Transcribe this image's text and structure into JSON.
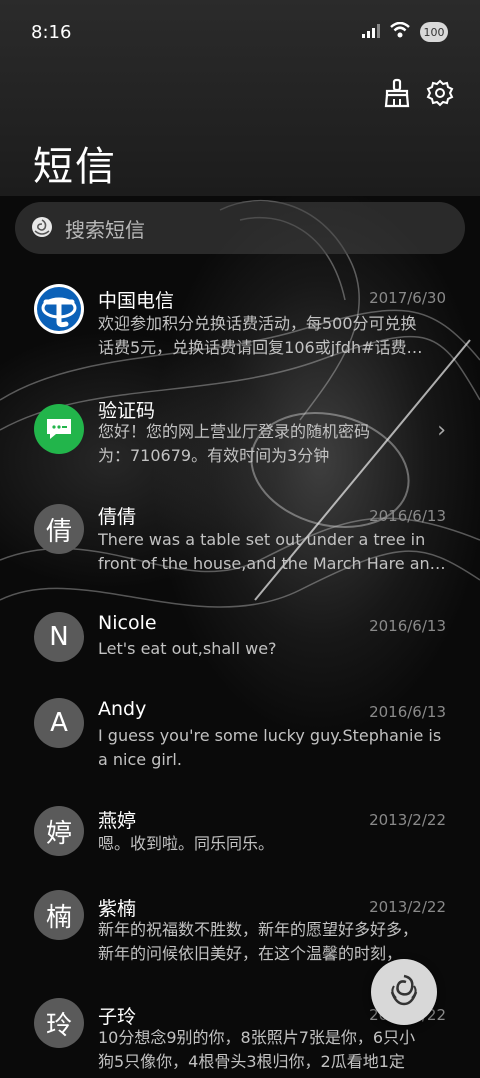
{
  "status_bar": {
    "time": "8:16",
    "battery": "100",
    "icons": [
      "signal-icon",
      "wifi-icon",
      "battery-icon"
    ]
  },
  "header": {
    "title": "短信",
    "icons": [
      "broom-clean-icon",
      "gear-icon"
    ]
  },
  "search": {
    "placeholder": "搜索短信",
    "icon": "rose-icon"
  },
  "messages": [
    {
      "name": "中国电信",
      "date": "2017/6/30",
      "avatar": "china-telecom-logo",
      "line1": "欢迎参加积分兑换话费活动，每500分可兑换",
      "line2": "话费5元，兑换话费请回复106或jfdh#话费…"
    },
    {
      "name": "验证码",
      "date": "",
      "avatar": "chat-bubble-icon",
      "line1": "您好！您的网上营业厅登录的随机密码",
      "line2": "为：710679。有效时间为3分钟"
    },
    {
      "name": "倩倩",
      "date": "2016/6/13",
      "avatar_text": "倩",
      "line1": "There was a table set out under a tree in",
      "line2": "front of the house,and the March Hare an…"
    },
    {
      "name": "Nicole",
      "date": "2016/6/13",
      "avatar_text": "N",
      "line1": "Let's eat out,shall we?"
    },
    {
      "name": "Andy",
      "date": "2016/6/13",
      "avatar_text": "A",
      "line1": "I guess you're some lucky guy.Stephanie is",
      "line2": "a nice girl."
    },
    {
      "name": "燕婷",
      "date": "2013/2/22",
      "avatar_text": "婷",
      "line1": "嗯。收到啦。同乐同乐。"
    },
    {
      "name": "紫楠",
      "date": "2013/2/22",
      "avatar_text": "楠",
      "line1": "新年的祝福数不胜数，新年的愿望好多好多，",
      "line2": "新年的问候依旧美好，在这个温馨的时刻，"
    },
    {
      "name": "子玲",
      "date": "2013/2/22",
      "avatar_text": "玲",
      "line1": "10分想念9别的你，8张照片7张是你，6只小",
      "line2": "狗5只像你，4根骨头3根归你，2瓜看地1定"
    }
  ],
  "fab": {
    "icon": "rose-icon"
  },
  "colors": {
    "background": "#0a0a0a",
    "header": "#2b2b2b",
    "avatar": "#5a5a5a",
    "telecom_blue": "#0b61b8",
    "chat_green": "#22b54b"
  }
}
